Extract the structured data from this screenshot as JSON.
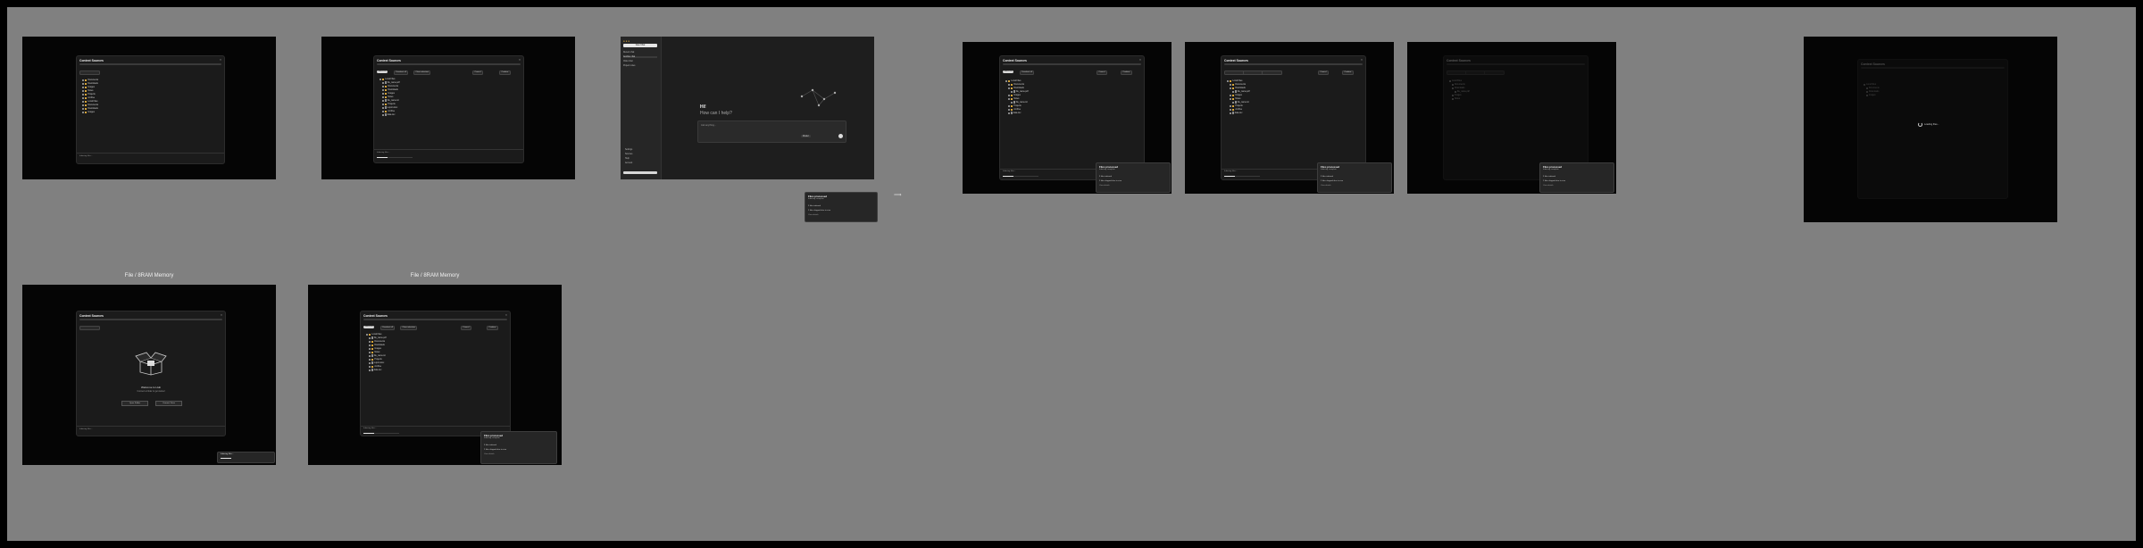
{
  "captions": {
    "a": "File / 8RAM Memory",
    "b": "File / 8RAM Memory"
  },
  "modal": {
    "title": "Context Sources",
    "close_icon": "close-icon",
    "buttons": {
      "primary": "Select all",
      "secondary": "Deselect all",
      "tertiary": "Clear selection",
      "cancel": "Cancel",
      "confirm": "Confirm"
    },
    "tree": [
      {
        "label": "Local Files",
        "kind": "folder"
      },
      {
        "label": "Documents",
        "kind": "folder"
      },
      {
        "label": "Downloads",
        "kind": "folder"
      },
      {
        "label": "file_name.pdf",
        "kind": "file"
      },
      {
        "label": "Images",
        "kind": "folder"
      },
      {
        "label": "Notes",
        "kind": "folder"
      },
      {
        "label": "file_name.txt",
        "kind": "file"
      },
      {
        "label": "Projects",
        "kind": "folder"
      },
      {
        "label": "report.docx",
        "kind": "file"
      },
      {
        "label": "Archive",
        "kind": "folder"
      },
      {
        "label": "data.csv",
        "kind": "file"
      }
    ],
    "footer_status": "Indexing files...",
    "empty_title": "Welcome to Hub",
    "empty_desc": "Connect a folder to get started",
    "empty_btn_a": "Open Folder",
    "empty_btn_b": "Connect Drive"
  },
  "chat": {
    "new_chat": "New Chat",
    "greeting_a": "Hi!",
    "greeting_b": "How can I help?",
    "input_placeholder": "Ask anything...",
    "model": "Model",
    "sidebar_items": [
      "Recent chat",
      "Another chat",
      "Older chat",
      "Project notes"
    ],
    "bottom_items": [
      "Settings",
      "Sources",
      "Help",
      "Account"
    ]
  },
  "toast": {
    "title": "Files processed",
    "subtitle": "Indexing complete",
    "rows": [
      "3 files indexed",
      "2 files skipped due to size",
      "View details"
    ]
  },
  "loading_text": "Loading files..."
}
